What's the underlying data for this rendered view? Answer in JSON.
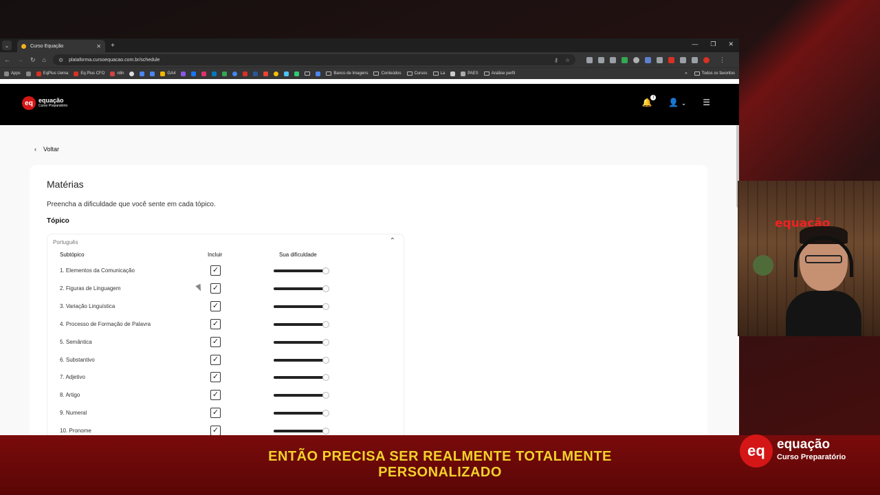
{
  "browser": {
    "tab_title": "Curso Equação",
    "url": "plataforma.cursoequacao.com.br/schedule",
    "bookmarks": [
      "Apps",
      "EqPlus Uema",
      "Eq Plus CFO",
      "n8n",
      "GA4",
      "Banco de Imagens",
      "Conteúdos",
      "Cursos",
      "La",
      "PAES",
      "Análise perfil"
    ],
    "all_bookmarks": "Todos os favoritos"
  },
  "site": {
    "logo_text": "equação",
    "logo_sub": "Curso Preparatório",
    "notification_count": "1",
    "back_label": "Voltar",
    "title": "Matérias",
    "description": "Preencha a dificuldade que você sente em cada tópico.",
    "topic_heading": "Tópico",
    "topic": {
      "name": "Português",
      "col_subtopic": "Subtópico",
      "col_include": "Incluir",
      "col_difficulty": "Sua dificuldade",
      "rows": [
        {
          "label": "1. Elementos da Comunicação",
          "included": true,
          "difficulty": 0.95
        },
        {
          "label": "2. Figuras de Linguagem",
          "included": true,
          "difficulty": 0.95
        },
        {
          "label": "3. Variação Linguística",
          "included": true,
          "difficulty": 0.95
        },
        {
          "label": "4. Processo de Formação de Palavra",
          "included": true,
          "difficulty": 0.95
        },
        {
          "label": "5. Semântica",
          "included": true,
          "difficulty": 0.95
        },
        {
          "label": "6. Substantivo",
          "included": true,
          "difficulty": 0.95
        },
        {
          "label": "7. Adjetivo",
          "included": true,
          "difficulty": 0.95
        },
        {
          "label": "8. Artigo",
          "included": true,
          "difficulty": 0.95
        },
        {
          "label": "9. Numeral",
          "included": true,
          "difficulty": 0.95
        },
        {
          "label": "10. Pronome",
          "included": true,
          "difficulty": 0.95
        }
      ]
    }
  },
  "overlay": {
    "caption_line1": "ENTÃO PRECISA SER REALMENTE TOTALMENTE",
    "caption_line2": "PERSONALIZADO",
    "brand_name": "equação",
    "brand_sub": "Curso Preparatório",
    "cam_logo": "equação"
  },
  "colors": {
    "brand_red": "#d41616",
    "caption_yellow": "#f2d22b"
  }
}
